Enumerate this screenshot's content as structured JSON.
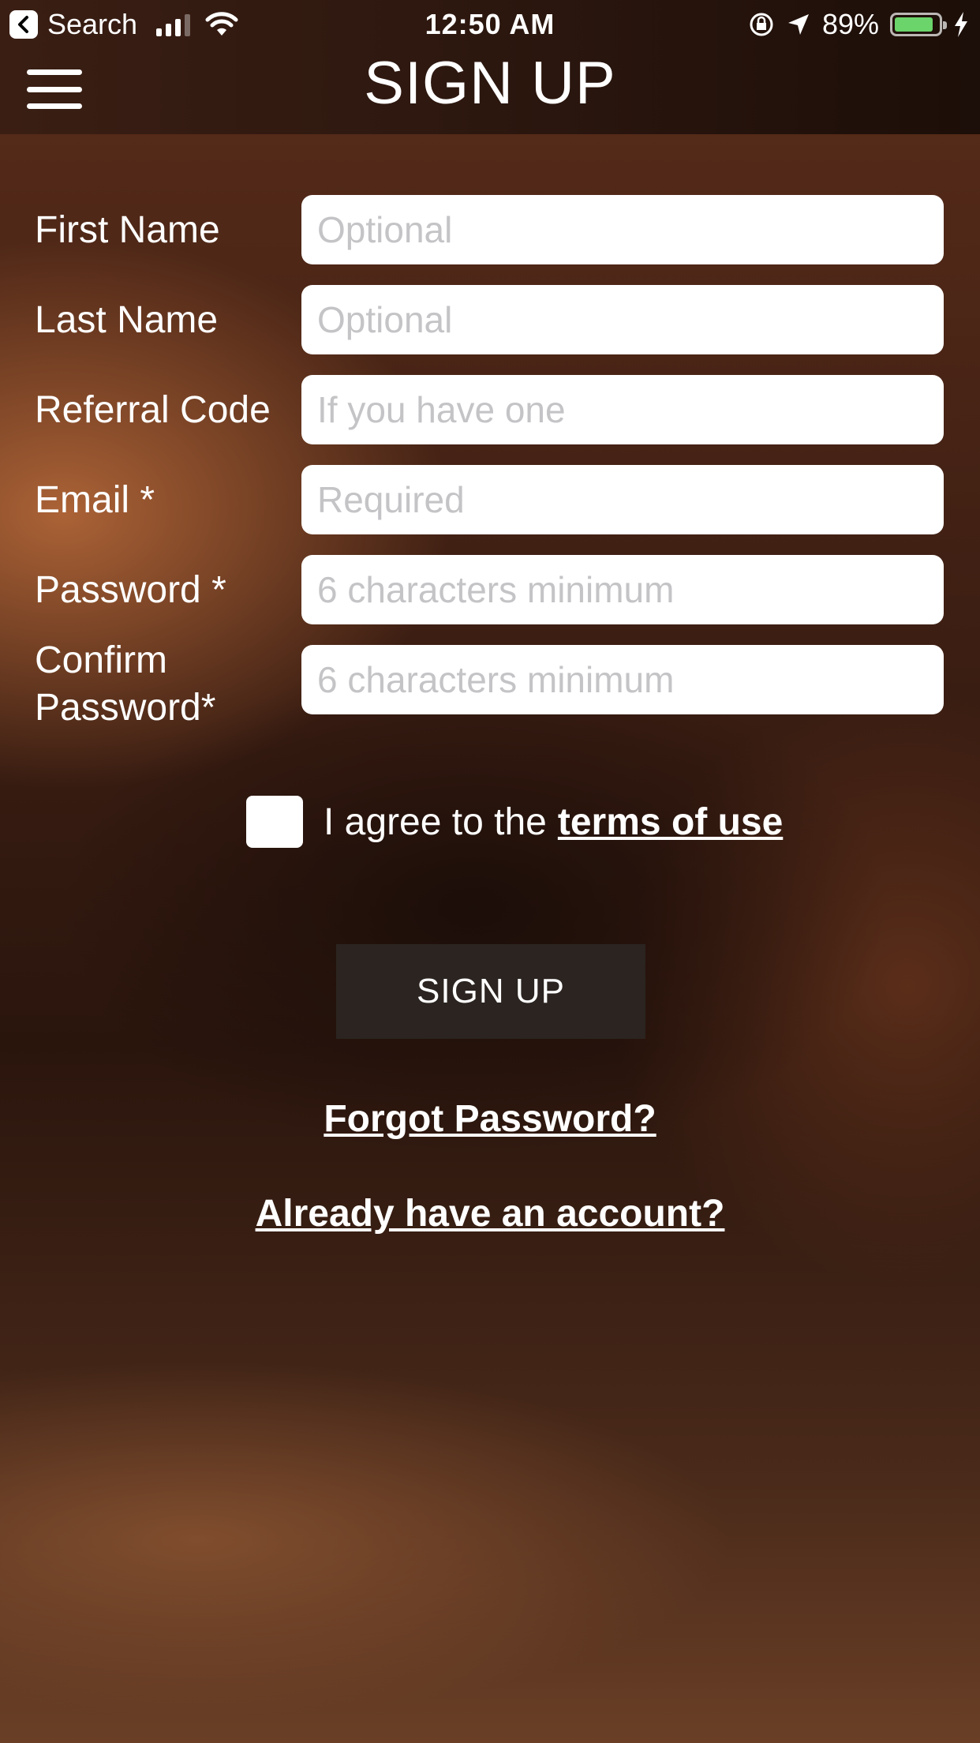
{
  "status_bar": {
    "back_label": "Search",
    "time": "12:50 AM",
    "battery": "89%",
    "battery_level": 0.89,
    "battery_color": "#6bd46b"
  },
  "header": {
    "title": "SIGN UP",
    "menu_icon": "hamburger-icon"
  },
  "form": {
    "fields": [
      {
        "label": "First Name",
        "placeholder": "Optional",
        "value": ""
      },
      {
        "label": "Last Name",
        "placeholder": "Optional",
        "value": ""
      },
      {
        "label": "Referral Code",
        "placeholder": "If you have one",
        "value": ""
      },
      {
        "label": "Email *",
        "placeholder": "Required",
        "value": ""
      },
      {
        "label": "Password *",
        "placeholder": "6 characters minimum",
        "value": ""
      },
      {
        "label_line1": "Confirm",
        "label_line2": "Password*",
        "placeholder": "6 characters minimum",
        "value": ""
      }
    ]
  },
  "terms": {
    "text": "I agree to the",
    "link": "terms of use",
    "checked": false
  },
  "actions": {
    "signup_label": "SIGN UP",
    "forgot_password": "Forgot Password?",
    "have_account": "Already have an account?"
  }
}
